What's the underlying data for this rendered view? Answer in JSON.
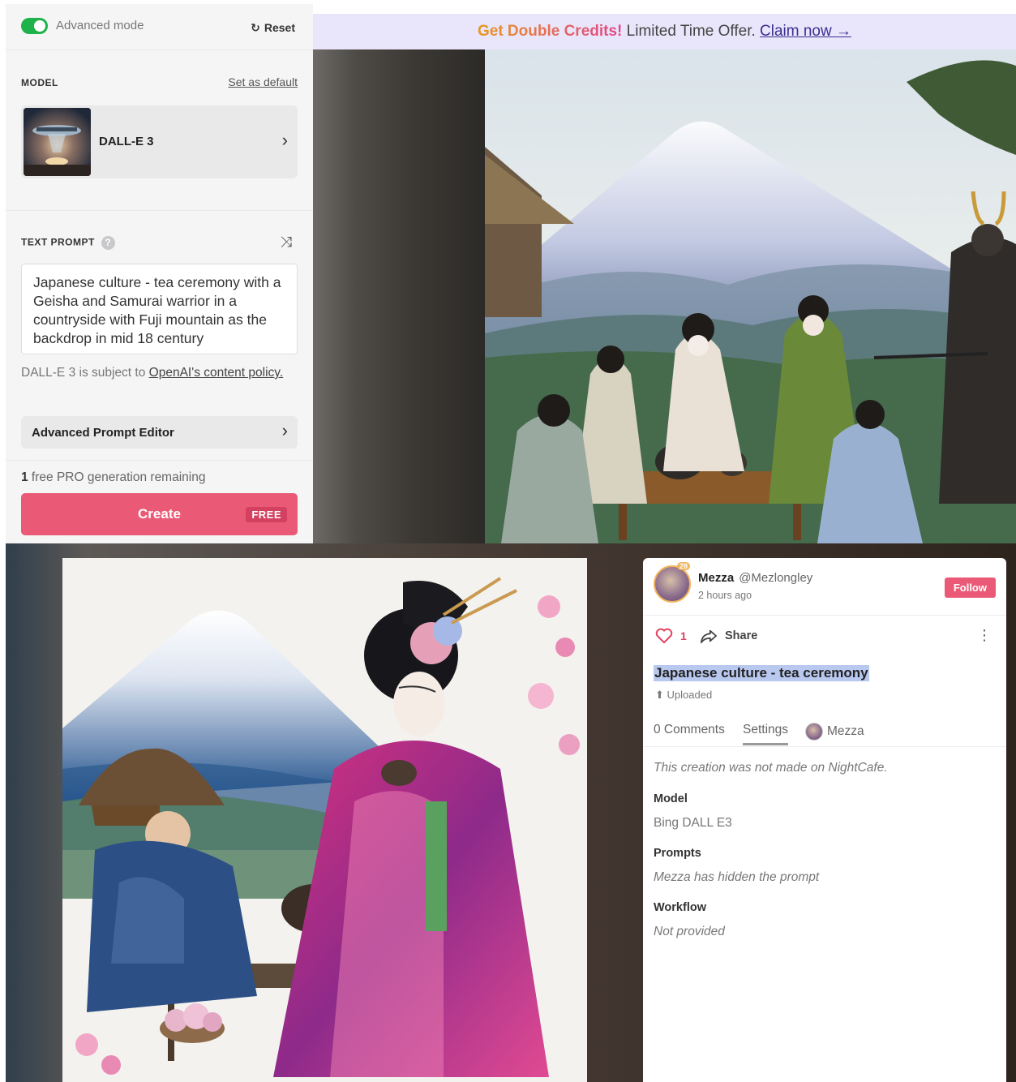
{
  "generator": {
    "advanced_mode_label": "Advanced mode",
    "reset_label": "Reset",
    "model_section_label": "MODEL",
    "set_default_label": "Set as default",
    "model_name": "DALL-E 3",
    "text_prompt_label": "TEXT PROMPT",
    "prompt_value": "Japanese culture - tea ceremony with a Geisha and Samurai warrior in a countryside with Fuji mountain as the backdrop in mid 18 century",
    "policy_prefix": "DALL-E 3 is subject to ",
    "policy_link": "OpenAI's content policy.",
    "advanced_prompt_editor_label": "Advanced Prompt Editor",
    "remaining_count": "1",
    "remaining_text": " free PRO generation remaining",
    "create_label": "Create",
    "free_badge": "FREE"
  },
  "promo": {
    "highlight": "Get Double Credits!",
    "text": " Limited Time Offer. ",
    "cta": "Claim now →"
  },
  "creation": {
    "user_name": "Mezza",
    "user_handle": "@Mezlongley",
    "user_level": "28",
    "posted_ago": "2 hours ago",
    "follow_label": "Follow",
    "like_count": "1",
    "share_label": "Share",
    "title": "Japanese culture - tea ceremony",
    "uploaded_label": "Uploaded",
    "tabs": [
      {
        "label": "0 Comments"
      },
      {
        "label": "Settings"
      },
      {
        "label": "Mezza"
      }
    ],
    "note": "This creation was not made on NightCafe.",
    "model_label": "Model",
    "model_value": "Bing DALL E3",
    "prompts_label": "Prompts",
    "prompts_value": "Mezza has hidden the prompt",
    "workflow_label": "Workflow",
    "workflow_value": "Not provided"
  },
  "colors": {
    "accent_pink": "#ea5a76",
    "toggle_green": "#1fb24a",
    "promo_bg": "#e9e6fb",
    "title_highlight": "#b9c8ef"
  },
  "icons": {
    "reset": "refresh-icon",
    "model_chevron": "chevron-right-icon",
    "prompt_help": "help-icon",
    "prompt_shuffle": "shuffle-icon",
    "like": "heart-icon",
    "share": "share-icon",
    "more": "kebab-icon",
    "upload": "upload-icon"
  }
}
